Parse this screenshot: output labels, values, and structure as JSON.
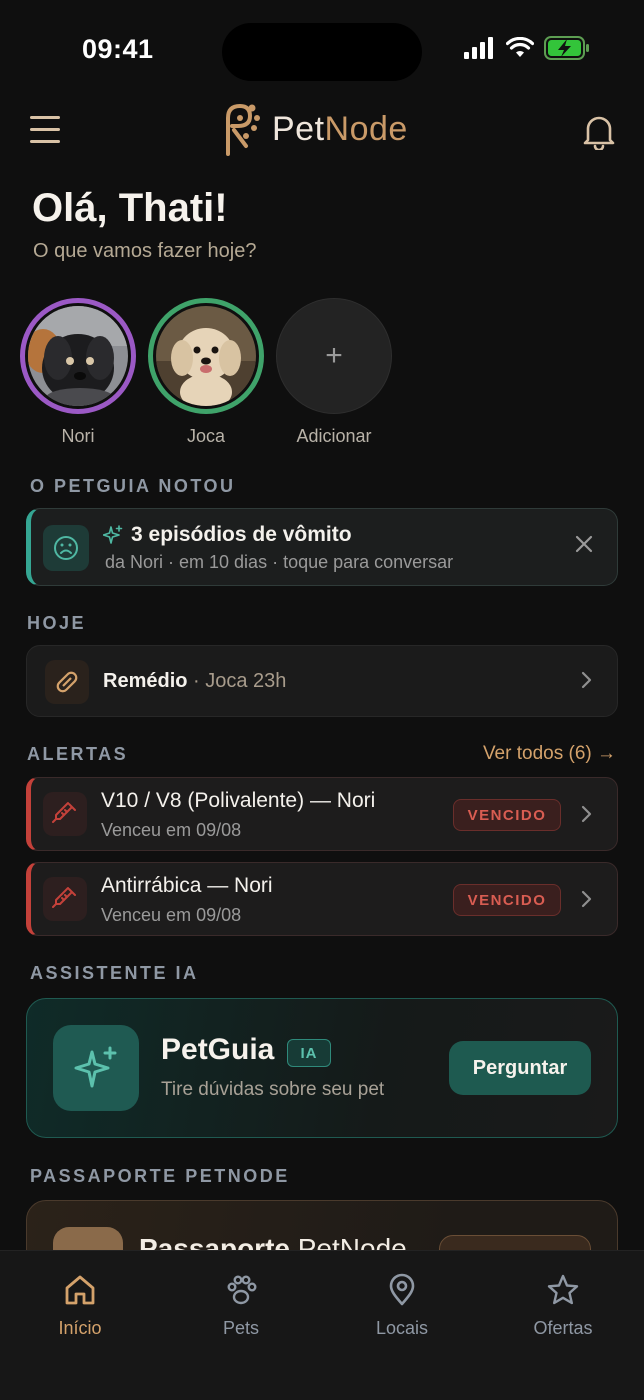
{
  "status_bar": {
    "time": "09:41"
  },
  "header": {
    "logo_pet": "Pet",
    "logo_node": "Node"
  },
  "greeting": {
    "title": "Olá, Thati!",
    "subtitle": "O que vamos fazer hoje?"
  },
  "pets": [
    {
      "name": "Nori",
      "ring_color": "#9b59c5"
    },
    {
      "name": "Joca",
      "ring_color": "#3fa36a"
    }
  ],
  "add_pet": {
    "label": "Adicionar",
    "symbol": "+"
  },
  "petguia_noticed": {
    "section_label": "O PETGUIA NOTOU",
    "title": "3 episódios de vômito",
    "subtitle": "da Nori · em 10 dias · toque para conversar"
  },
  "today": {
    "section_label": "HOJE",
    "item_title": "Remédio",
    "item_detail": " · Joca 23h"
  },
  "alerts": {
    "section_label": "ALERTAS",
    "see_all": "Ver todos (6) →",
    "items": [
      {
        "title": "V10 / V8 (Polivalente) — Nori",
        "subtitle": "Venceu em 09/08",
        "badge": "VENCIDO"
      },
      {
        "title": "Antirrábica — Nori",
        "subtitle": "Venceu em 09/08",
        "badge": "VENCIDO"
      }
    ]
  },
  "assistant": {
    "section_label": "ASSISTENTE IA",
    "name": "PetGuia",
    "badge": "IA",
    "subtitle": "Tire dúvidas sobre seu pet",
    "button": "Perguntar"
  },
  "passport": {
    "section_label": "PASSAPORTE PETNODE",
    "title_a": "Passaporte ",
    "title_b": "PetNode"
  },
  "bottom_nav": [
    {
      "label": "Início",
      "icon": "home-icon",
      "active": true
    },
    {
      "label": "Pets",
      "icon": "paw-icon",
      "active": false
    },
    {
      "label": "Locais",
      "icon": "location-pin-icon",
      "active": false
    },
    {
      "label": "Ofertas",
      "icon": "star-icon",
      "active": false
    }
  ],
  "colors": {
    "accent": "#d4a26b",
    "teal": "#35a693",
    "danger": "#c4413a",
    "background": "#0f0f0f"
  }
}
